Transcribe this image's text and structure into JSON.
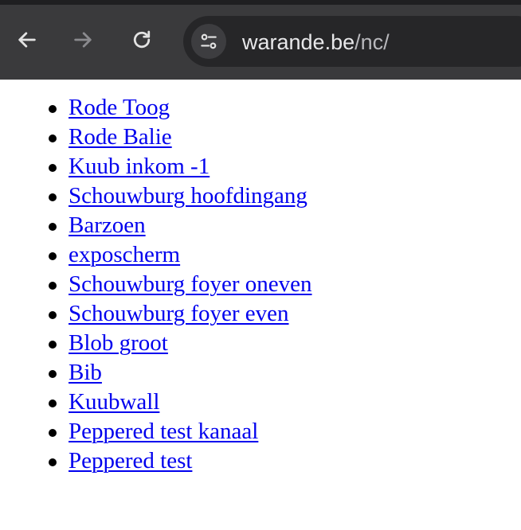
{
  "toolbar": {
    "back_icon": "arrow-left-icon",
    "forward_icon": "arrow-right-icon",
    "reload_icon": "reload-icon",
    "site_info_icon": "tune-icon",
    "url_domain": "warande.be",
    "url_path": "/nc/",
    "colors": {
      "toolbar_bg": "#3a3a3c",
      "omnibox_bg": "#262628",
      "url_text": "#e8e8ea",
      "url_path_text": "#b8b8bc"
    }
  },
  "links": [
    {
      "label": "Rode Toog"
    },
    {
      "label": "Rode Balie"
    },
    {
      "label": "Kuub inkom -1"
    },
    {
      "label": "Schouwburg hoofdingang"
    },
    {
      "label": "Barzoen"
    },
    {
      "label": "exposcherm"
    },
    {
      "label": "Schouwburg foyer oneven"
    },
    {
      "label": "Schouwburg foyer even"
    },
    {
      "label": "Blob groot"
    },
    {
      "label": "Bib"
    },
    {
      "label": "Kuubwall"
    },
    {
      "label": "Peppered test kanaal"
    },
    {
      "label": "Peppered test"
    }
  ],
  "colors": {
    "link": "#0000ee",
    "bullet": "#000000",
    "page_bg": "#ffffff"
  }
}
